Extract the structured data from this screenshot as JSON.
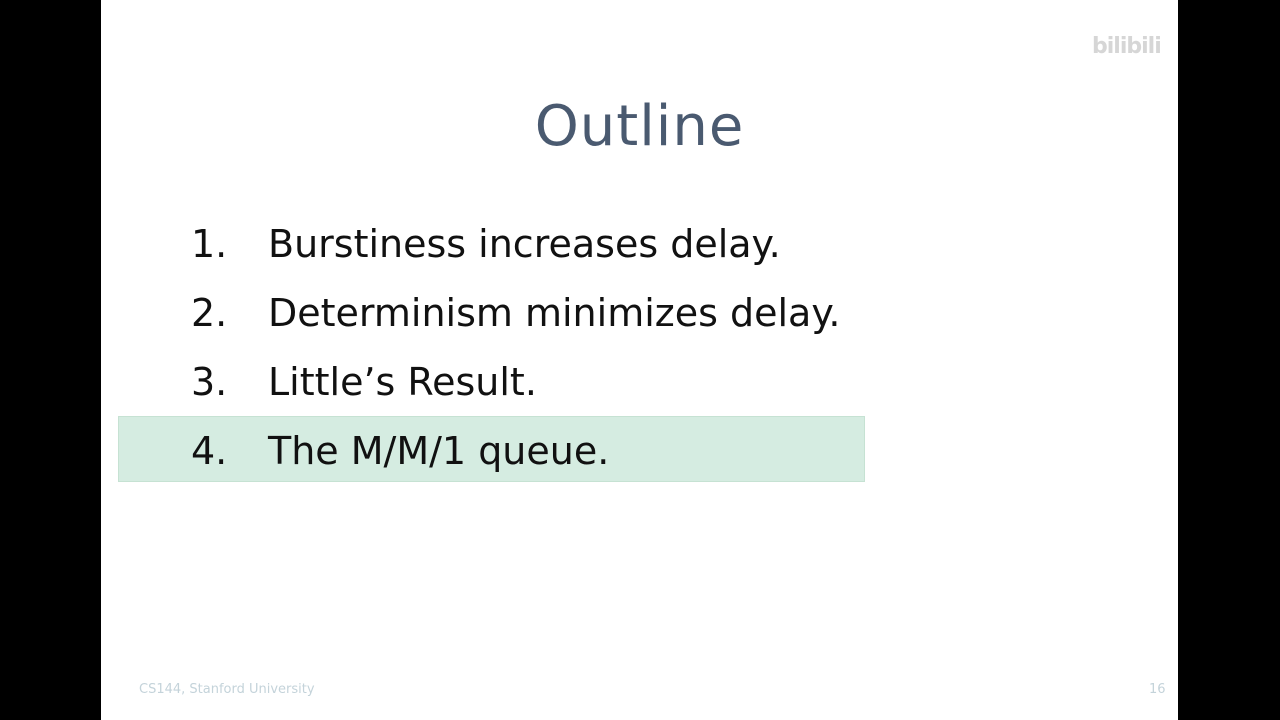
{
  "slide": {
    "title": "Outline",
    "items": [
      {
        "number": "1.",
        "text": "Burstiness increases delay."
      },
      {
        "number": "2.",
        "text": "Determinism minimizes delay."
      },
      {
        "number": "3.",
        "text": "Little’s Result."
      },
      {
        "number": "4.",
        "text": "The M/M/1 queue."
      }
    ],
    "highlighted_item": 4,
    "footer_left": "CS144, Stanford University",
    "page_number": "16"
  },
  "watermark": {
    "logo": "bilibili"
  },
  "colors": {
    "title": "#4a5a70",
    "highlight": "#d5ece1",
    "footer": "#c4d3da",
    "background": "#000000"
  }
}
